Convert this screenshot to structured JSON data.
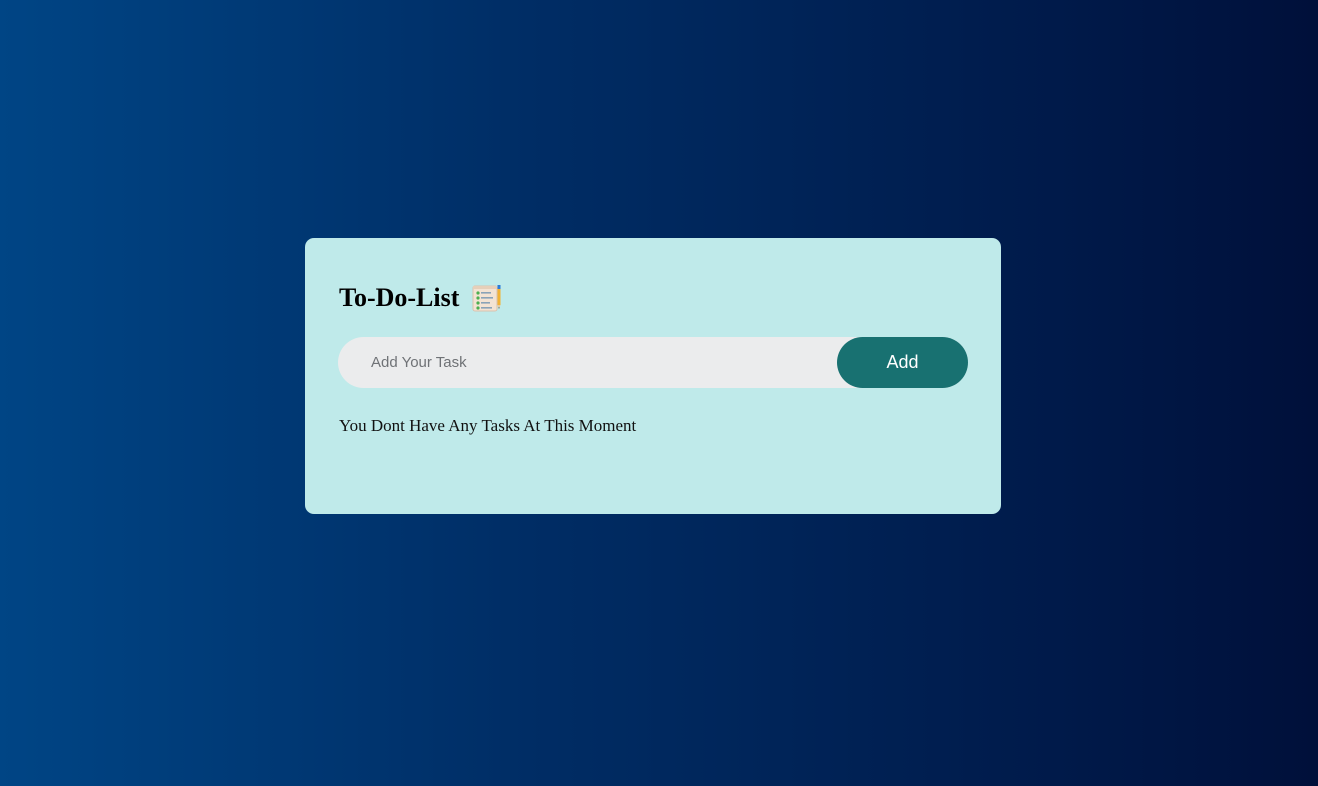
{
  "app": {
    "title": "To-Do-List",
    "title_icon": "checklist-notepad-icon"
  },
  "input": {
    "placeholder": "Add Your Task",
    "value": ""
  },
  "add_button": {
    "label": "Add"
  },
  "tasks": [],
  "empty_message": "You Dont Have Any Tasks At This Moment",
  "colors": {
    "background_start": "#004585",
    "background_end": "#00103a",
    "card": "#bfeaea",
    "input_bg": "#ebeced",
    "button": "#187171",
    "button_text": "#ffffff"
  }
}
